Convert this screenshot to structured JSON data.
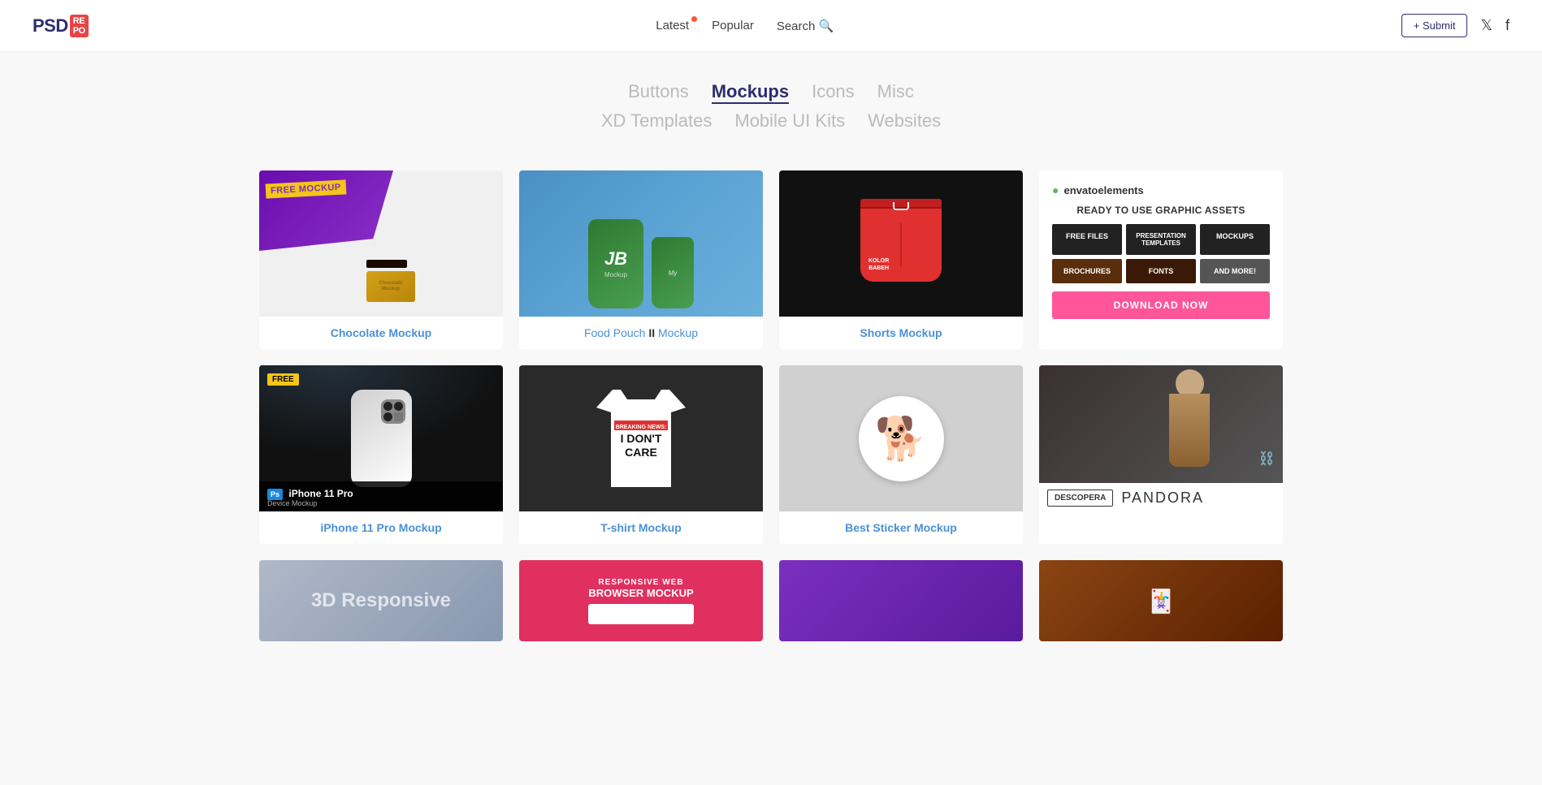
{
  "header": {
    "logo_text": "PSD",
    "logo_badge": "RE\nPO",
    "nav": {
      "latest": "Latest",
      "popular": "Popular",
      "search": "Search"
    },
    "submit_label": "+ Submit",
    "twitter_label": "Twitter",
    "facebook_label": "Facebook"
  },
  "categories": {
    "row1": [
      "Buttons",
      "Mockups",
      "Icons",
      "Misc"
    ],
    "row2": [
      "XD Templates",
      "Mobile UI Kits",
      "Websites"
    ],
    "active": "Mockups"
  },
  "row1": {
    "cards": [
      {
        "id": "chocolate",
        "badge": "FREE MOCKUP",
        "title_plain": "Chocolate Mockup",
        "title_link": "Chocolate Mockup",
        "free": true
      },
      {
        "id": "food-pouch",
        "title_plain": "Food Pouch II Mockup",
        "title_highlight": "II",
        "free": false
      },
      {
        "id": "shorts",
        "title_plain": "Shorts Mockup",
        "brand": "KOLOR\nBABEH",
        "free": false
      }
    ],
    "ad": {
      "brand": "envatoelements",
      "tagline": "READY TO USE GRAPHIC ASSETS",
      "cells": [
        "FREE FILES",
        "PRESENTATION TEMPLATES",
        "MOCKUPS",
        "BROCHURES",
        "FONTS",
        "AND MORE!"
      ],
      "cta": "DOWNLOAD NOW"
    }
  },
  "row2": {
    "cards": [
      {
        "id": "iphone",
        "badge": "FREE",
        "ps_label": "Ps",
        "title_main": "iPhone 11 Pro",
        "title_sub": "Device Mockup",
        "title_link": "iPhone 11 Pro Mockup"
      },
      {
        "id": "tshirt",
        "news_label": "BREAKING NEWS:",
        "main_text": "I DON'T\nCARE",
        "title_link": "T-shirt Mockup"
      },
      {
        "id": "sticker",
        "emoji": "🐶",
        "title_link": "Best Sticker Mockup"
      }
    ],
    "pandora_ad": {
      "btn_label": "DESCOPERA",
      "brand": "PANDORA"
    }
  },
  "row3": {
    "cards": [
      {
        "id": "3d-responsive",
        "label": "3D Responsive"
      },
      {
        "id": "responsive-web",
        "sub": "RESPONSIVE WEB",
        "main": "BROWSER MOCKUP"
      },
      {
        "id": "purple-card"
      }
    ]
  }
}
